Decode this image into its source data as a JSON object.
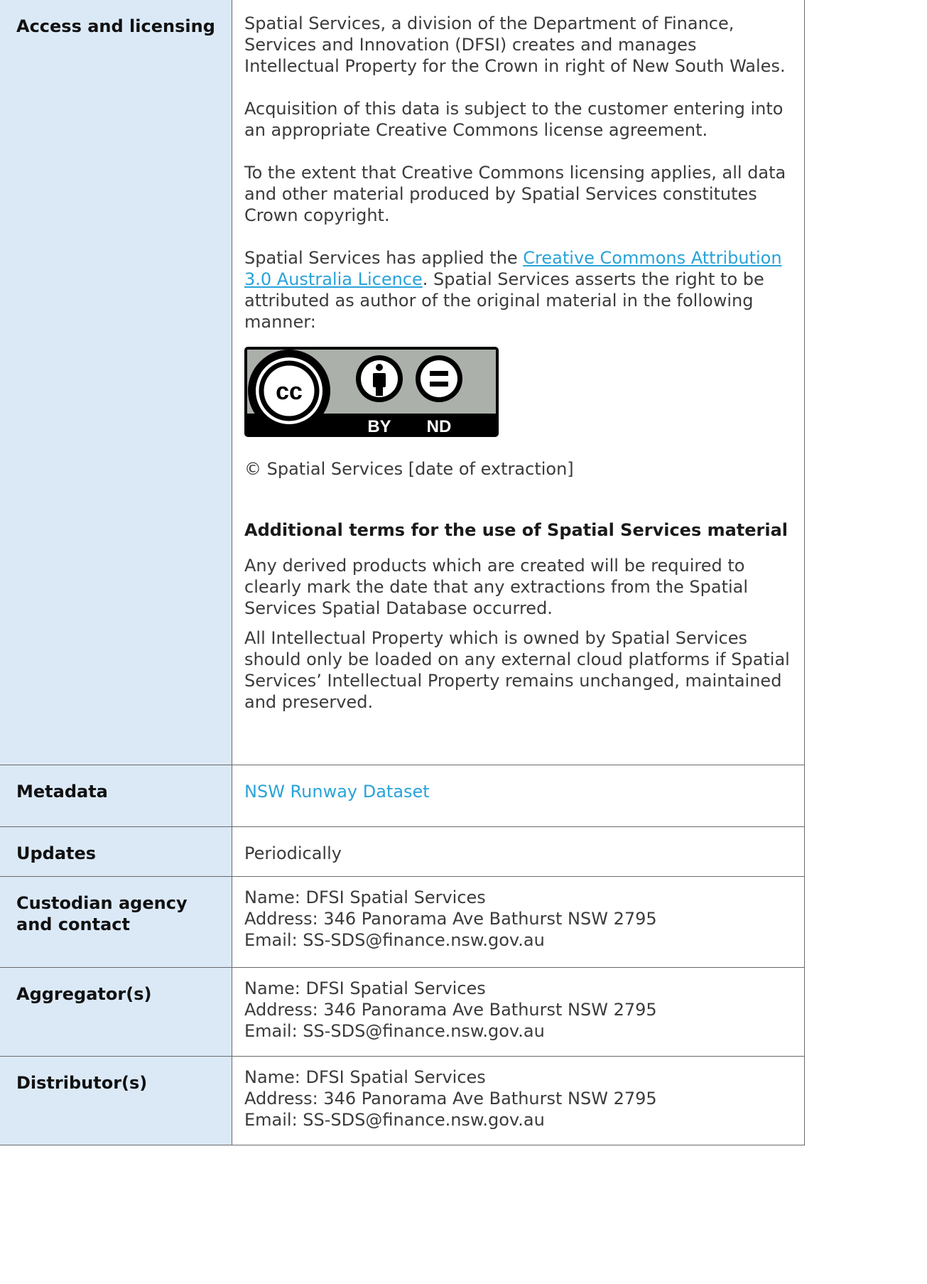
{
  "rows": {
    "access": {
      "label": "Access and licensing",
      "p1": "Spatial Services, a division of the Department of Finance, Services and Innovation (DFSI) creates and manages Intellectual Property for the Crown in right of New South Wales.",
      "p2": "Acquisition of this data is subject to the customer entering into an appropriate Creative Commons license agreement.",
      "p3": "To the extent that Creative Commons licensing applies, all data and other material produced by Spatial Services constitutes Crown copyright.",
      "p4_before": "Spatial Services has applied the ",
      "p4_link": "Creative Commons Attribution 3.0 Australia Licence",
      "p4_after": ". Spatial Services asserts the right to be attributed as author of the original material in the following manner:",
      "cc_badge": {
        "cc": "cc",
        "by": "BY",
        "nd": "ND"
      },
      "copyright": "© Spatial Services [date of extraction]",
      "subheading": "Additional terms for the use of Spatial Services material",
      "p5": "Any derived products which are created will be required to clearly mark the date that any extractions from the Spatial Services Spatial Database occurred.",
      "p6": "All Intellectual Property which is owned by Spatial Services should only be loaded on any external cloud platforms if Spatial Services’ Intellectual Property remains unchanged, maintained and preserved."
    },
    "metadata": {
      "label": "Metadata",
      "value": "NSW Runway Dataset"
    },
    "updates": {
      "label": "Updates",
      "value": "Periodically"
    },
    "custodian": {
      "label": "Custodian agency and contact",
      "name": "Name: DFSI Spatial Services",
      "address": "Address: 346 Panorama Ave Bathurst NSW 2795",
      "email": "Email: SS-SDS@finance.nsw.gov.au"
    },
    "aggregator": {
      "label": "Aggregator(s)",
      "name": "Name: DFSI Spatial Services",
      "address": "Address: 346 Panorama Ave Bathurst NSW 2795",
      "email": "Email: SS-SDS@finance.nsw.gov.au"
    },
    "distributor": {
      "label": "Distributor(s)",
      "name": "Name: DFSI Spatial Services",
      "address": "Address: 346 Panorama Ave Bathurst NSW 2795",
      "email": "Email: SS-SDS@finance.nsw.gov.au"
    }
  },
  "colors": {
    "label_bg": "#dbe9f7",
    "link": "#29a3d8",
    "border": "#6a6a6a",
    "body_text": "#3b3b3b"
  }
}
